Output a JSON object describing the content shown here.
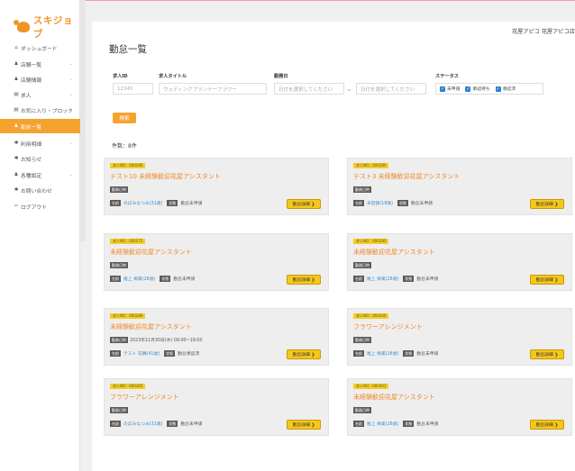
{
  "brand": {
    "name": "スキジョブ"
  },
  "sidebar": {
    "items": [
      {
        "label": "ダッシュボード",
        "icon": "home-icon",
        "glyph": "⌂",
        "chevron": false,
        "active": false
      },
      {
        "label": "店舗一覧",
        "icon": "users-icon",
        "glyph": "♟",
        "chevron": true,
        "active": false
      },
      {
        "label": "店舗情報",
        "icon": "users-icon",
        "glyph": "♟",
        "chevron": true,
        "active": false
      },
      {
        "label": "求人",
        "icon": "list-icon",
        "glyph": "▤",
        "chevron": true,
        "active": false
      },
      {
        "label": "お気に入り・ブロック",
        "icon": "list-icon",
        "glyph": "▤",
        "chevron": true,
        "active": false
      },
      {
        "label": "勤怠一覧",
        "icon": "users-icon",
        "glyph": "♟",
        "chevron": false,
        "active": true
      },
      {
        "label": "利用明細",
        "icon": "gear-icon",
        "glyph": "✱",
        "chevron": true,
        "active": false
      },
      {
        "label": "お知らせ",
        "icon": "gear-icon",
        "glyph": "✱",
        "chevron": false,
        "active": false
      },
      {
        "label": "各種設定",
        "icon": "users-icon",
        "glyph": "♟",
        "chevron": true,
        "active": false
      },
      {
        "label": "お問い合わせ",
        "icon": "gear-icon",
        "glyph": "✱",
        "chevron": false,
        "active": false
      },
      {
        "label": "ログアウト",
        "icon": "logout-icon",
        "glyph": "⇦",
        "chevron": false,
        "active": false
      }
    ]
  },
  "header": {
    "user": "花屋アピコ 花屋アピコ店"
  },
  "page": {
    "title": "勤怠一覧"
  },
  "filters": {
    "job_id": {
      "label": "求人ID",
      "value": "12345"
    },
    "job_title": {
      "label": "求人タイトル",
      "placeholder": "ウェディングプランナーフラワー"
    },
    "date": {
      "label": "勤務日",
      "from_placeholder": "日付を選択してください",
      "to_placeholder": "日付を選択してください",
      "separator": "~"
    },
    "status": {
      "label": "ステータス",
      "options": [
        "未申請",
        "承認待ち",
        "承認済"
      ]
    },
    "search_label": "検索"
  },
  "results": {
    "count_text": "件数：8件"
  },
  "cards": [
    {
      "job_no": "求人NO：000280",
      "title": "テスト10 未経験歓迎花屋アシスタント",
      "work_label": "勤務日時",
      "work_time": "",
      "name_tag": "名前",
      "name": "のぼみなつみ(31歳)",
      "status_tag": "状態",
      "status": "勤怠未申請",
      "detail": "勤怠詳細 ❯"
    },
    {
      "job_no": "求人NO：000280",
      "title": "テスト3 未経験歓迎花屋アシスタント",
      "work_label": "勤務日時",
      "work_time": "",
      "name_tag": "名前",
      "name": "未登録(18歳)",
      "status_tag": "状態",
      "status": "勤怠未申請",
      "detail": "勤怠詳細 ❯"
    },
    {
      "job_no": "求人NO：000275",
      "title": "未経験歓迎花屋アシスタント",
      "work_label": "勤務日時",
      "work_time": "",
      "name_tag": "名前",
      "name": "尾上 栄美(28歳)",
      "status_tag": "状態",
      "status": "勤怠未申請",
      "detail": "勤怠詳細 ❯"
    },
    {
      "job_no": "求人NO：000285",
      "title": "未経験歓迎花屋アシスタント",
      "work_label": "勤務日時",
      "work_time": "",
      "name_tag": "名前",
      "name": "尾上 栄美(28歳)",
      "status_tag": "状態",
      "status": "勤怠未申請",
      "detail": "勤怠詳細 ❯"
    },
    {
      "job_no": "求人NO：000289",
      "title": "未経験歓迎花屋アシスタント",
      "work_label": "勤務日時",
      "work_time": "2023年11月30日(木) 09:00~19:00",
      "name_tag": "名前",
      "name": "テスト 花舞(41歳)",
      "status_tag": "状態",
      "status": "勤怠承認済",
      "detail": "勤怠詳細 ❯"
    },
    {
      "job_no": "求人NO：000300",
      "title": "フラワーアレンジメント",
      "work_label": "勤務日時",
      "work_time": "",
      "name_tag": "名前",
      "name": "尾上 栄美(28歳)",
      "status_tag": "状態",
      "status": "勤怠未申請",
      "detail": "勤怠詳細 ❯"
    },
    {
      "job_no": "求人NO：000305",
      "title": "フラワーアレンジメント",
      "work_label": "勤務日時",
      "work_time": "",
      "name_tag": "名前",
      "name": "のぼみなつみ(31歳)",
      "status_tag": "状態",
      "status": "勤怠未申請",
      "detail": "勤怠詳細 ❯"
    },
    {
      "job_no": "求人NO：000301",
      "title": "未経験歓迎花屋アシスタント",
      "work_label": "勤務日時",
      "work_time": "",
      "name_tag": "名前",
      "name": "尾上 栄美(28歳)",
      "status_tag": "状態",
      "status": "勤怠未申請",
      "detail": "勤怠詳細 ❯"
    }
  ]
}
